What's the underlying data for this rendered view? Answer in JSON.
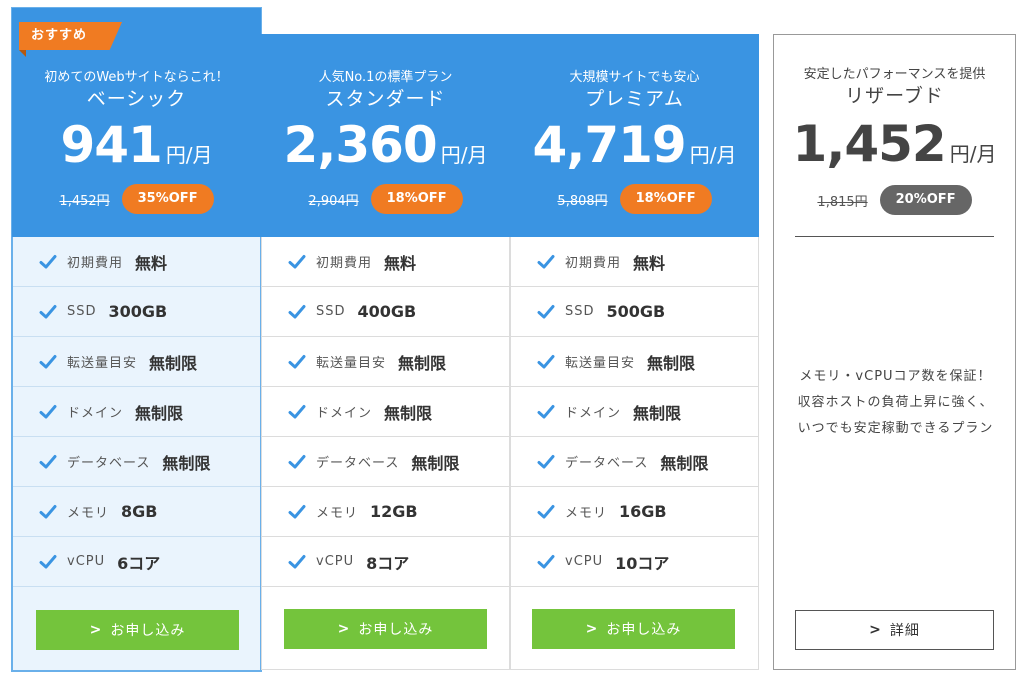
{
  "badge": "おすすめ",
  "plans": [
    {
      "tagline": "初めてのWebサイトならこれ！",
      "name": "ベーシック",
      "price": "941",
      "unit": "円/月",
      "old_price": "1,452円",
      "discount": "35%OFF",
      "features": [
        {
          "label": "初期費用",
          "value": "無料"
        },
        {
          "label": "SSD",
          "value": "300GB"
        },
        {
          "label": "転送量目安",
          "value": "無制限"
        },
        {
          "label": "ドメイン",
          "value": "無制限"
        },
        {
          "label": "データベース",
          "value": "無制限"
        },
        {
          "label": "メモリ",
          "value": "8GB"
        },
        {
          "label": "vCPU",
          "value": "6コア"
        }
      ],
      "button": "お申し込み"
    },
    {
      "tagline": "人気No.1の標準プラン",
      "name": "スタンダード",
      "price": "2,360",
      "unit": "円/月",
      "old_price": "2,904円",
      "discount": "18%OFF",
      "features": [
        {
          "label": "初期費用",
          "value": "無料"
        },
        {
          "label": "SSD",
          "value": "400GB"
        },
        {
          "label": "転送量目安",
          "value": "無制限"
        },
        {
          "label": "ドメイン",
          "value": "無制限"
        },
        {
          "label": "データベース",
          "value": "無制限"
        },
        {
          "label": "メモリ",
          "value": "12GB"
        },
        {
          "label": "vCPU",
          "value": "8コア"
        }
      ],
      "button": "お申し込み"
    },
    {
      "tagline": "大規模サイトでも安心",
      "name": "プレミアム",
      "price": "4,719",
      "unit": "円/月",
      "old_price": "5,808円",
      "discount": "18%OFF",
      "features": [
        {
          "label": "初期費用",
          "value": "無料"
        },
        {
          "label": "SSD",
          "value": "500GB"
        },
        {
          "label": "転送量目安",
          "value": "無制限"
        },
        {
          "label": "ドメイン",
          "value": "無制限"
        },
        {
          "label": "データベース",
          "value": "無制限"
        },
        {
          "label": "メモリ",
          "value": "16GB"
        },
        {
          "label": "vCPU",
          "value": "10コア"
        }
      ],
      "button": "お申し込み"
    }
  ],
  "reserve": {
    "tagline": "安定したパフォーマンスを提供",
    "name": "リザーブド",
    "price": "1,452",
    "unit": "円/月",
    "old_price": "1,815円",
    "discount": "20%OFF",
    "description": "メモリ・vCPUコア数を保証！収容ホストの負荷上昇に強く、いつでも安定稼動できるプラン",
    "button": "詳細"
  },
  "colors": {
    "header_blue": "#3a94e2",
    "highlight_bg": "#eaf4fd",
    "highlight_border": "#6ab0ea",
    "discount_orange": "#f07b22",
    "reserve_badge_gray": "#666666",
    "apply_green": "#74c43c",
    "check_blue": "#3a94e2"
  },
  "icons": {
    "feature": "check-icon",
    "button": "chevron-right-icon",
    "badge": "ribbon-icon"
  }
}
